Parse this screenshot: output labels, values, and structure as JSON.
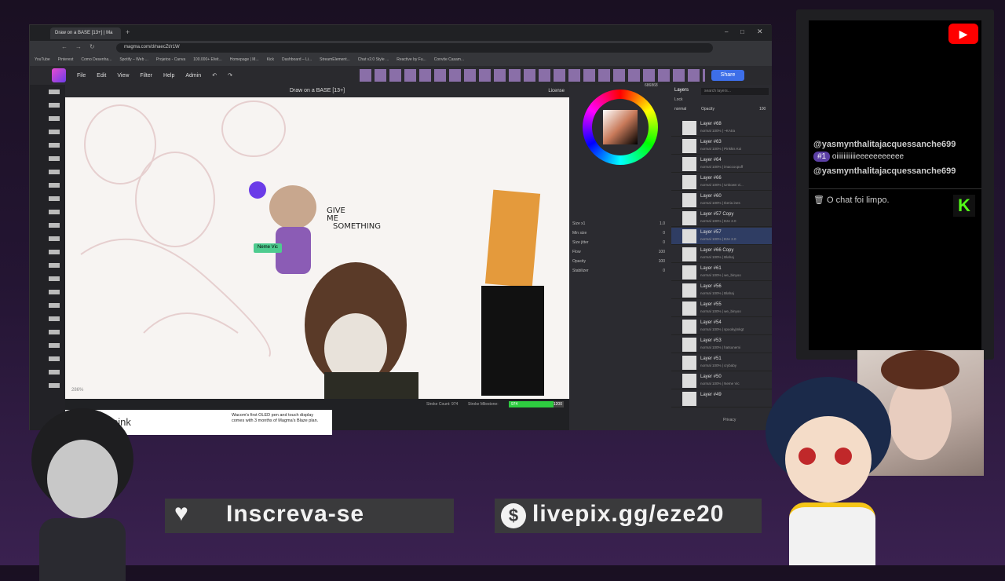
{
  "browser": {
    "tab_title": "Draw on a BASE [13+] | Ma",
    "url": "magma.com/d/naecZt/r1W",
    "bookmarks": [
      "YouTube",
      "Pinterest",
      "Como Desenha...",
      "Spotify – Web ...",
      "Projetos - Canva",
      "100.000+ Efeit...",
      "Homepage | M...",
      "Kick",
      "Dashboard – Li...",
      "StreamElement...",
      "Chat v2.0 Style ...",
      "Reactive by Fu...",
      "Convite Casam..."
    ]
  },
  "app": {
    "menu": [
      "File",
      "Edit",
      "View",
      "Filter",
      "Help",
      "Admin"
    ],
    "share_label": "Share",
    "canvas_title": "Draw on a BASE [13+]",
    "license_label": "License",
    "zoom": "286%",
    "user_tag": "Neme Vic",
    "drawing_text": [
      "GIVE",
      "ME",
      "SOMETHING"
    ],
    "stroke_count_label": "Stroke Count: 974",
    "stroke_milestone_label": "Stroke Milestone:",
    "stroke_value": "974",
    "stroke_target": "1200",
    "stroke_progress": 0.81,
    "ad_text": "Wacom's first OLED pen and touch display comes with 3 months of Magma's Blaze plan.",
    "ad_brand": "pink",
    "privacy_label": "Privacy"
  },
  "brush_panel": {
    "hex": "686868",
    "rows": [
      {
        "label": "Size x1",
        "value": "1.0"
      },
      {
        "label": "Min size",
        "value": "0"
      },
      {
        "label": "Size jitter",
        "value": "0"
      },
      {
        "label": "Flow",
        "value": "100"
      },
      {
        "label": "Opacity",
        "value": "100"
      },
      {
        "label": "Stabilizer",
        "value": "0"
      }
    ]
  },
  "layers_panel": {
    "tab_label": "Layers",
    "lock_label": "Lock",
    "search_placeholder": "search layers...",
    "blend": "normal",
    "opacity_label": "Opacity",
    "opacity_value": "100",
    "layers": [
      {
        "name": "Layer #68",
        "sub": "normal 100% | ~KAtra"
      },
      {
        "name": "Layer #63",
        "sub": "normal 100% | Pinkkis Koi"
      },
      {
        "name": "Layer #64",
        "sub": "normal 100% | imaccocpuff"
      },
      {
        "name": "Layer #66",
        "sub": "normal 100% | Unkown vi..."
      },
      {
        "name": "Layer #60",
        "sub": "normal 100% | Ikeria ines"
      },
      {
        "name": "Layer #57 Copy",
        "sub": "normal 100% | Eze 2.0"
      },
      {
        "name": "Layer #57",
        "sub": "normal 100% | Eze 2.0"
      },
      {
        "name": "Layer #66 Copy",
        "sub": "normal 100% | Blahaj"
      },
      {
        "name": "Layer #61",
        "sub": "normal 100% | we_binyoo"
      },
      {
        "name": "Layer #56",
        "sub": "normal 100% | Blahaj"
      },
      {
        "name": "Layer #55",
        "sub": "normal 100% | we_binyoo"
      },
      {
        "name": "Layer #54",
        "sub": "normal 100% | spookyjmkgt"
      },
      {
        "name": "Layer #53",
        "sub": "normal 100% | hatsunemi"
      },
      {
        "name": "Layer #51",
        "sub": "normal 100% | crybaby"
      },
      {
        "name": "Layer #50",
        "sub": "normal 100% | Neme Vic"
      },
      {
        "name": "Layer #49",
        "sub": ""
      }
    ]
  },
  "chat": {
    "user1": "@yasmynthalitajacquessanche699",
    "badge": "#1",
    "msg1": "oiiiiiiiiiiieeeeeeeeeee",
    "user2": "@yasmynthalitajacquessanche699",
    "system_msg": "O chat foi limpo."
  },
  "overlay": {
    "subscribe_label": "Inscreva-se",
    "livepix_label": "livepix.gg/eze",
    "livepix_suffix": "20"
  },
  "colors": {
    "accent": "#3d6ee8",
    "progress": "#2ecc40",
    "kick": "#53fc18",
    "youtube": "#ff0000",
    "selected_layer": "#2f3d63"
  }
}
